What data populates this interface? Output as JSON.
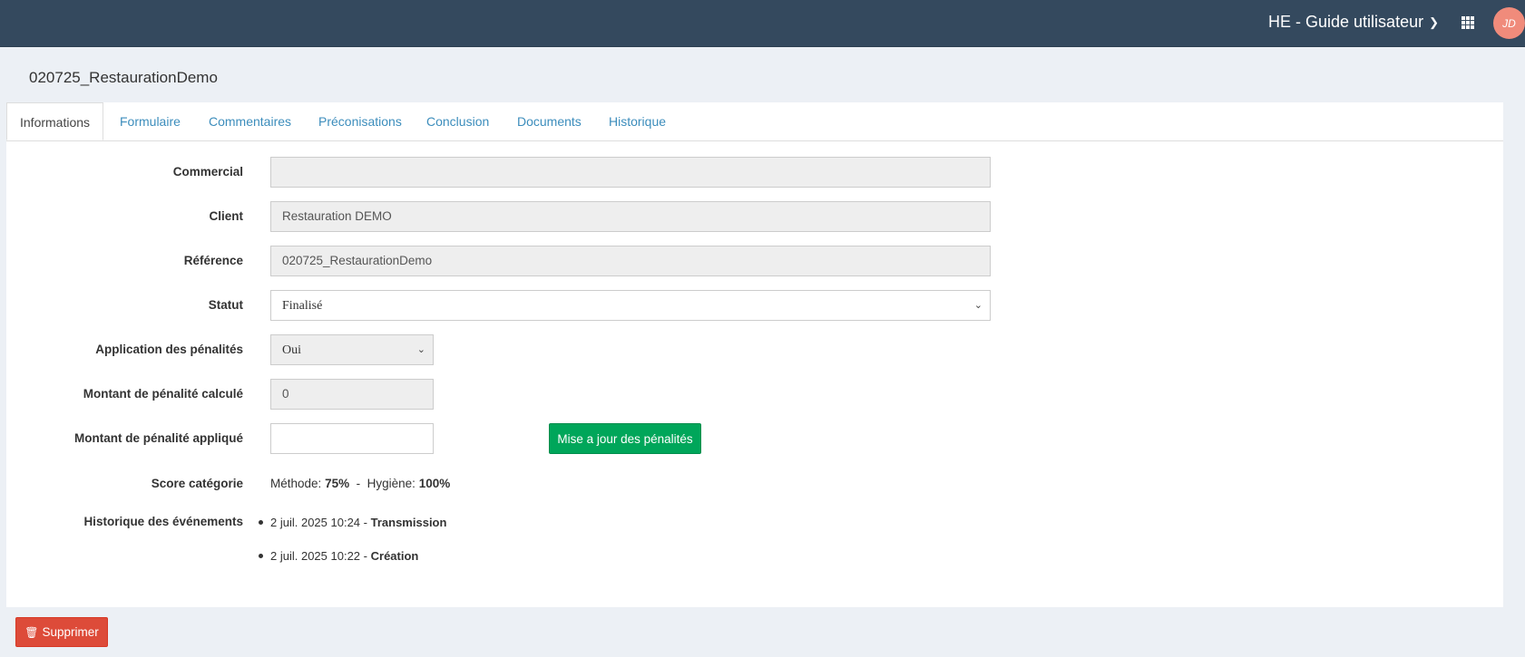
{
  "header": {
    "user_menu_label": "HE - Guide utilisateur",
    "avatar_initials": "JD"
  },
  "page": {
    "title": "020725_RestaurationDemo"
  },
  "tabs": [
    {
      "label": "Informations",
      "active": true
    },
    {
      "label": "Formulaire"
    },
    {
      "label": "Commentaires"
    },
    {
      "label": "Préconisations"
    },
    {
      "label": "Conclusion"
    },
    {
      "label": "Documents"
    },
    {
      "label": "Historique"
    }
  ],
  "form": {
    "commercial": {
      "label": "Commercial",
      "value": ""
    },
    "client": {
      "label": "Client",
      "value": "Restauration DEMO"
    },
    "reference": {
      "label": "Référence",
      "value": "020725_RestaurationDemo"
    },
    "statut": {
      "label": "Statut",
      "value": "Finalisé"
    },
    "application_penalites": {
      "label": "Application des pénalités",
      "value": "Oui"
    },
    "montant_calcule": {
      "label": "Montant de pénalité calculé",
      "value": "0"
    },
    "montant_applique": {
      "label": "Montant de pénalité appliqué",
      "value": ""
    },
    "update_button": "Mise a jour des pénalités"
  },
  "score": {
    "label": "Score catégorie",
    "methode_label": "Méthode:",
    "methode_value": "75%",
    "separator": "-",
    "hygiene_label": "Hygiène:",
    "hygiene_value": "100%"
  },
  "history": {
    "label": "Historique des événements",
    "events": [
      {
        "date": "2 juil. 2025 10:24",
        "sep": "-",
        "event": "Transmission"
      },
      {
        "date": "2 juil. 2025 10:22",
        "sep": "-",
        "event": "Création"
      }
    ]
  },
  "actions": {
    "delete_label": "Supprimer"
  },
  "colors": {
    "topbar": "#34495e",
    "link": "#3c8dbc",
    "success": "#00a65a",
    "danger": "#dd4b39"
  }
}
